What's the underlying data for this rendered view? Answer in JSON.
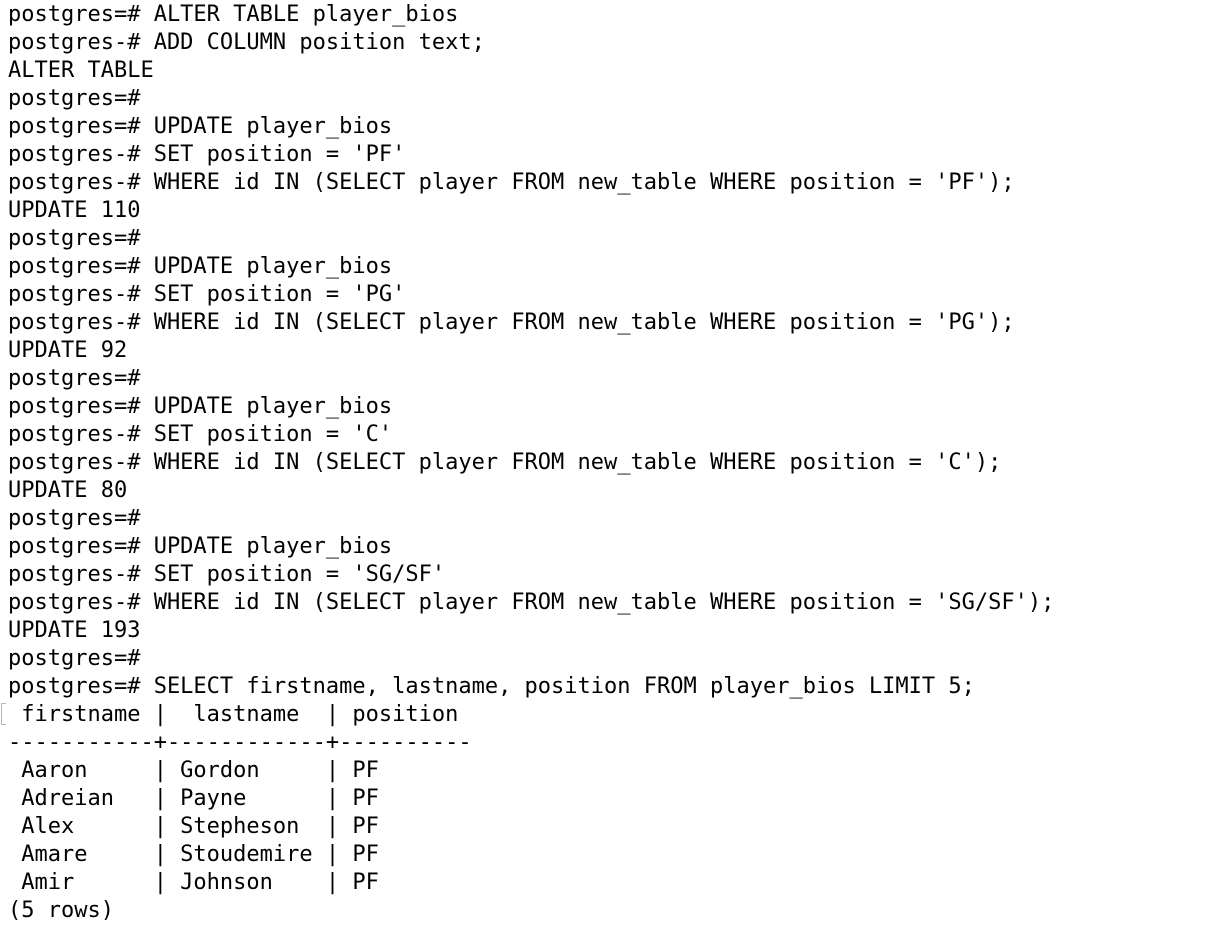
{
  "terminal": {
    "lines": [
      "postgres=# ALTER TABLE player_bios",
      "postgres-# ADD COLUMN position text;",
      "ALTER TABLE",
      "postgres=#",
      "postgres=# UPDATE player_bios",
      "postgres-# SET position = 'PF'",
      "postgres-# WHERE id IN (SELECT player FROM new_table WHERE position = 'PF');",
      "UPDATE 110",
      "postgres=#",
      "postgres=# UPDATE player_bios",
      "postgres-# SET position = 'PG'",
      "postgres-# WHERE id IN (SELECT player FROM new_table WHERE position = 'PG');",
      "UPDATE 92",
      "postgres=#",
      "postgres=# UPDATE player_bios",
      "postgres-# SET position = 'C'",
      "postgres-# WHERE id IN (SELECT player FROM new_table WHERE position = 'C');",
      "UPDATE 80",
      "postgres=#",
      "postgres=# UPDATE player_bios",
      "postgres-# SET position = 'SG/SF'",
      "postgres-# WHERE id IN (SELECT player FROM new_table WHERE position = 'SG/SF');",
      "UPDATE 193",
      "postgres=#",
      "postgres=# SELECT firstname, lastname, position FROM player_bios LIMIT 5;",
      " firstname |  lastname  | position",
      "-----------+------------+----------",
      " Aaron     | Gordon     | PF",
      " Adreian   | Payne      | PF",
      " Alex      | Stepheson  | PF",
      " Amare     | Stoudemire | PF",
      " Amir      | Johnson    | PF",
      "(5 rows)"
    ]
  }
}
